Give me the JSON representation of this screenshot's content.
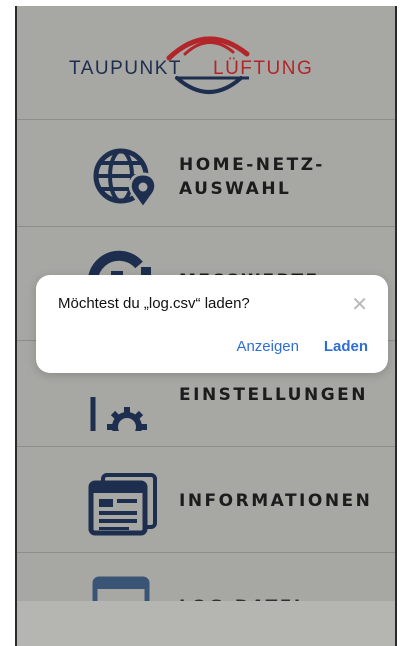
{
  "logo": {
    "part1": "TAUPUNKT",
    "part2": "LÜFTUNG"
  },
  "menu": [
    {
      "line1": "HOME-NETZ-",
      "line2": "AUSWAHL",
      "icon": "globe-location-icon"
    },
    {
      "line1": "MESSWERTE",
      "icon": "gauge-icon"
    },
    {
      "line1": "EINSTELLUNGEN",
      "icon": "settings-window-icon"
    },
    {
      "line1": "INFORMATIONEN",
      "icon": "information-window-icon"
    },
    {
      "line1": "LOG-DATEI",
      "icon": "code-window-icon"
    }
  ],
  "dialog": {
    "message": "Möchtest du „log.csv“ laden?",
    "close": "✕",
    "secondary_label": "Anzeigen",
    "primary_label": "Laden"
  },
  "colors": {
    "background": "#a7a7a4",
    "icon_navy": "#1d2e4e",
    "logo_red": "#b2262a",
    "link_blue": "#2f6fd4"
  }
}
